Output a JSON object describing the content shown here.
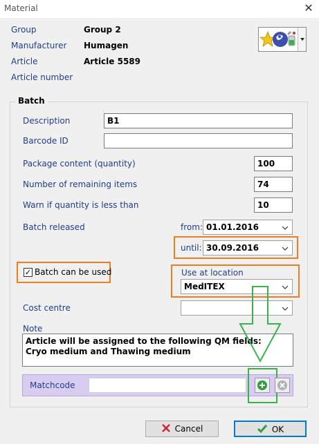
{
  "window": {
    "title": "Material",
    "close_glyph": "✕"
  },
  "header": {
    "group_label": "Group",
    "group_value": "Group 2",
    "manufacturer_label": "Manufacturer",
    "manufacturer_value": "Humagen",
    "article_label": "Article",
    "article_value": "Article 5589",
    "article_number_label": "Article number",
    "article_number_value": ""
  },
  "batch": {
    "title": "Batch",
    "description_label": "Description",
    "description_value": "B1",
    "barcode_label": "Barcode ID",
    "barcode_value": "",
    "package_label": "Package content (quantity)",
    "package_value": "100",
    "remaining_label": "Number of remaining items",
    "remaining_value": "74",
    "warn_label": "Warn if quantity is less than",
    "warn_value": "10",
    "released_label": "Batch released",
    "from_label": "from:",
    "from_value": "01.01.2016",
    "until_label": "until:",
    "until_value": "30.09.2016",
    "can_be_used_label": "Batch can be used",
    "can_be_used_checked": true,
    "location_label": "Use at location",
    "location_value": "MedITEX",
    "cost_centre_label": "Cost centre",
    "cost_centre_value": "",
    "note_label": "Note",
    "note_line1": "Article will be assigned to the following QM fields:",
    "note_line2": "Cryo medium and Thawing medium",
    "matchcode_label": "Matchcode",
    "matchcode_value": ""
  },
  "buttons": {
    "cancel_label": "Cancel",
    "ok_label": "OK"
  },
  "colors": {
    "highlight_orange": "#ee7d22",
    "highlight_green": "#37b34a",
    "matchcode_bg": "#d8ccf0"
  }
}
